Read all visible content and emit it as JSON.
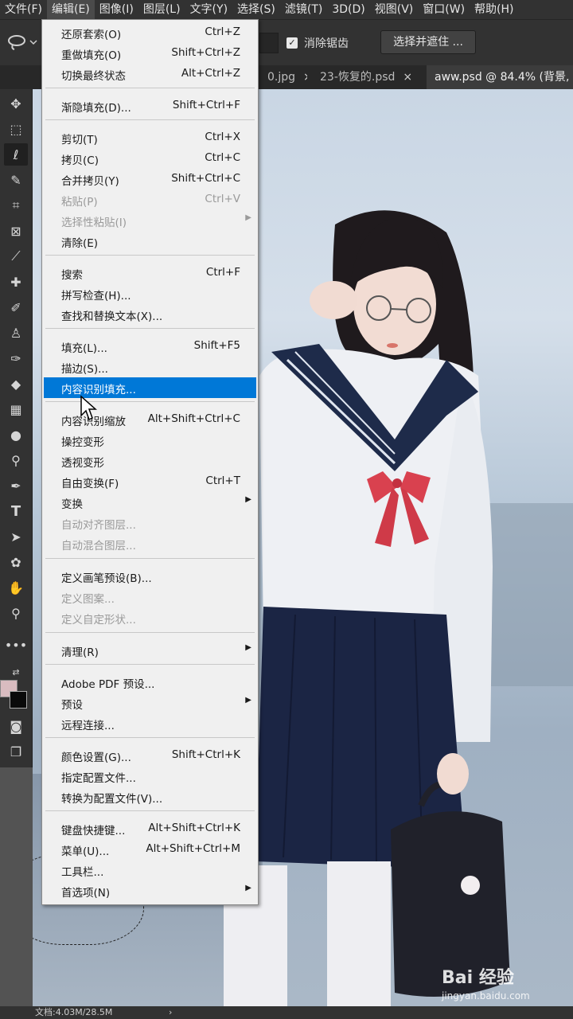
{
  "menubar": {
    "items": [
      "文件(F)",
      "编辑(E)",
      "图像(I)",
      "图层(L)",
      "文字(Y)",
      "选择(S)",
      "滤镜(T)",
      "3D(D)",
      "视图(V)",
      "窗口(W)",
      "帮助(H)"
    ],
    "active_index": 1
  },
  "options": {
    "antialias_label": "消除锯齿",
    "select_mask_label": "选择并遮住 ..."
  },
  "tabs": [
    {
      "label": "0.jpg",
      "close": "×"
    },
    {
      "label": "23-恢复的.psd",
      "close": "×"
    },
    {
      "label": "aww.psd @ 84.4% (背景,",
      "close": ""
    }
  ],
  "status": {
    "doc_info": "文档:4.03M/28.5M",
    "arrow": "›"
  },
  "watermark": {
    "brand": "Bai 经验",
    "sub": "jingyan.baidu.com"
  },
  "edit_menu": {
    "items": [
      {
        "label": "还原套索(O)",
        "shortcut": "Ctrl+Z"
      },
      {
        "label": "重做填充(O)",
        "shortcut": "Shift+Ctrl+Z"
      },
      {
        "label": "切换最终状态",
        "shortcut": "Alt+Ctrl+Z"
      },
      {
        "label": "渐隐填充(D)...",
        "shortcut": "Shift+Ctrl+F"
      },
      {
        "label": "剪切(T)",
        "shortcut": "Ctrl+X"
      },
      {
        "label": "拷贝(C)",
        "shortcut": "Ctrl+C"
      },
      {
        "label": "合并拷贝(Y)",
        "shortcut": "Shift+Ctrl+C"
      },
      {
        "label": "粘贴(P)",
        "shortcut": "Ctrl+V",
        "disabled": true
      },
      {
        "label": "选择性粘贴(I)",
        "shortcut": "",
        "disabled": true,
        "submenu": true
      },
      {
        "label": "清除(E)",
        "shortcut": ""
      },
      {
        "label": "搜索",
        "shortcut": "Ctrl+F"
      },
      {
        "label": "拼写检查(H)...",
        "shortcut": ""
      },
      {
        "label": "查找和替换文本(X)...",
        "shortcut": ""
      },
      {
        "label": "填充(L)...",
        "shortcut": "Shift+F5"
      },
      {
        "label": "描边(S)...",
        "shortcut": ""
      },
      {
        "label": "内容识别填充...",
        "shortcut": "",
        "highlighted": true
      },
      {
        "label": "内容识别缩放",
        "shortcut": "Alt+Shift+Ctrl+C"
      },
      {
        "label": "操控变形",
        "shortcut": ""
      },
      {
        "label": "透视变形",
        "shortcut": ""
      },
      {
        "label": "自由变换(F)",
        "shortcut": "Ctrl+T"
      },
      {
        "label": "变换",
        "shortcut": "",
        "submenu": true
      },
      {
        "label": "自动对齐图层...",
        "shortcut": "",
        "disabled": true
      },
      {
        "label": "自动混合图层...",
        "shortcut": "",
        "disabled": true
      },
      {
        "label": "定义画笔预设(B)...",
        "shortcut": ""
      },
      {
        "label": "定义图案...",
        "shortcut": "",
        "disabled": true
      },
      {
        "label": "定义自定形状...",
        "shortcut": "",
        "disabled": true
      },
      {
        "label": "清理(R)",
        "shortcut": "",
        "submenu": true
      },
      {
        "label": "Adobe PDF 预设...",
        "shortcut": ""
      },
      {
        "label": "预设",
        "shortcut": "",
        "submenu": true
      },
      {
        "label": "远程连接...",
        "shortcut": ""
      },
      {
        "label": "颜色设置(G)...",
        "shortcut": "Shift+Ctrl+K"
      },
      {
        "label": "指定配置文件...",
        "shortcut": ""
      },
      {
        "label": "转换为配置文件(V)...",
        "shortcut": ""
      },
      {
        "label": "键盘快捷键...",
        "shortcut": "Alt+Shift+Ctrl+K"
      },
      {
        "label": "菜单(U)...",
        "shortcut": "Alt+Shift+Ctrl+M"
      },
      {
        "label": "工具栏...",
        "shortcut": ""
      },
      {
        "label": "首选项(N)",
        "shortcut": "",
        "submenu": true
      }
    ],
    "submenu_arrow": "▶"
  },
  "icons": {
    "lasso": "lasso-icon",
    "move": "move-icon",
    "marquee": "rect-marquee-icon",
    "quick_select": "quick-select-icon",
    "crop": "crop-icon",
    "frame": "frame-icon",
    "eyedropper": "eyedropper-icon",
    "healing": "healing-brush-icon",
    "brush": "brush-icon",
    "stamp": "clone-stamp-icon",
    "history_brush": "history-brush-icon",
    "eraser": "eraser-icon",
    "gradient": "gradient-icon",
    "blur": "blur-icon",
    "dodge": "dodge-icon",
    "pen": "pen-icon",
    "type": "type-icon",
    "path_select": "path-select-icon",
    "shape": "shape-icon",
    "hand": "hand-icon",
    "zoom": "zoom-icon"
  },
  "colors": {
    "foreground": "#d9bcc0",
    "background": "#0a0a0a",
    "highlight": "#0078d7"
  }
}
